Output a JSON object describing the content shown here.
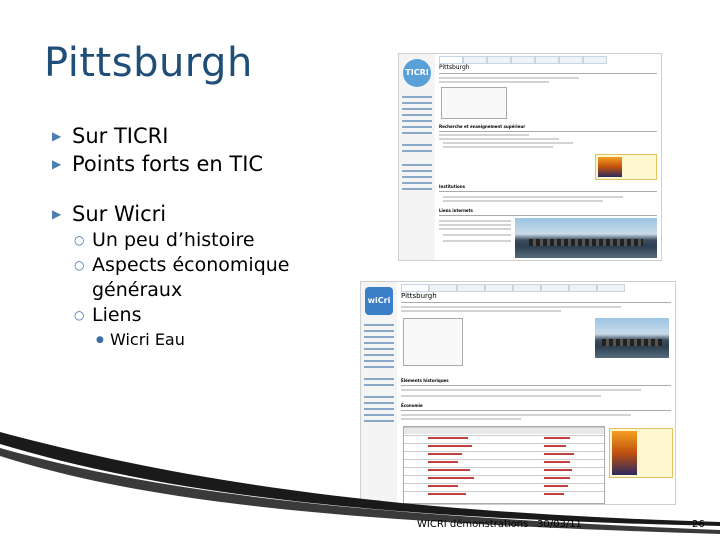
{
  "slide": {
    "title": "Pittsburgh",
    "bullets": {
      "item1": "Sur TICRI",
      "item2": "Points forts en TIC",
      "item3": "Sur Wicri",
      "sub1": "Un peu d’histoire",
      "sub2": "Aspects économique généraux",
      "sub3": "Liens",
      "subsub1": "Wicri Eau"
    }
  },
  "screenshot_top": {
    "logo_text": "TICRI",
    "page_title": "Pittsburgh",
    "sections": [
      "Recherche et enseignement supérieur",
      "Institutions",
      "Liens internets"
    ]
  },
  "screenshot_bottom": {
    "logo_text": "wiCri",
    "page_title": "Pittsburgh",
    "sections": [
      "Éléments historiques",
      "Économie"
    ]
  },
  "footer": {
    "label": "WICRI démonstrations",
    "date": "30/03/11",
    "page": "26"
  },
  "colors": {
    "title": "#1f4e79",
    "bullet_marker": "#4a7fb0",
    "swoosh": "#1a1a1a"
  }
}
